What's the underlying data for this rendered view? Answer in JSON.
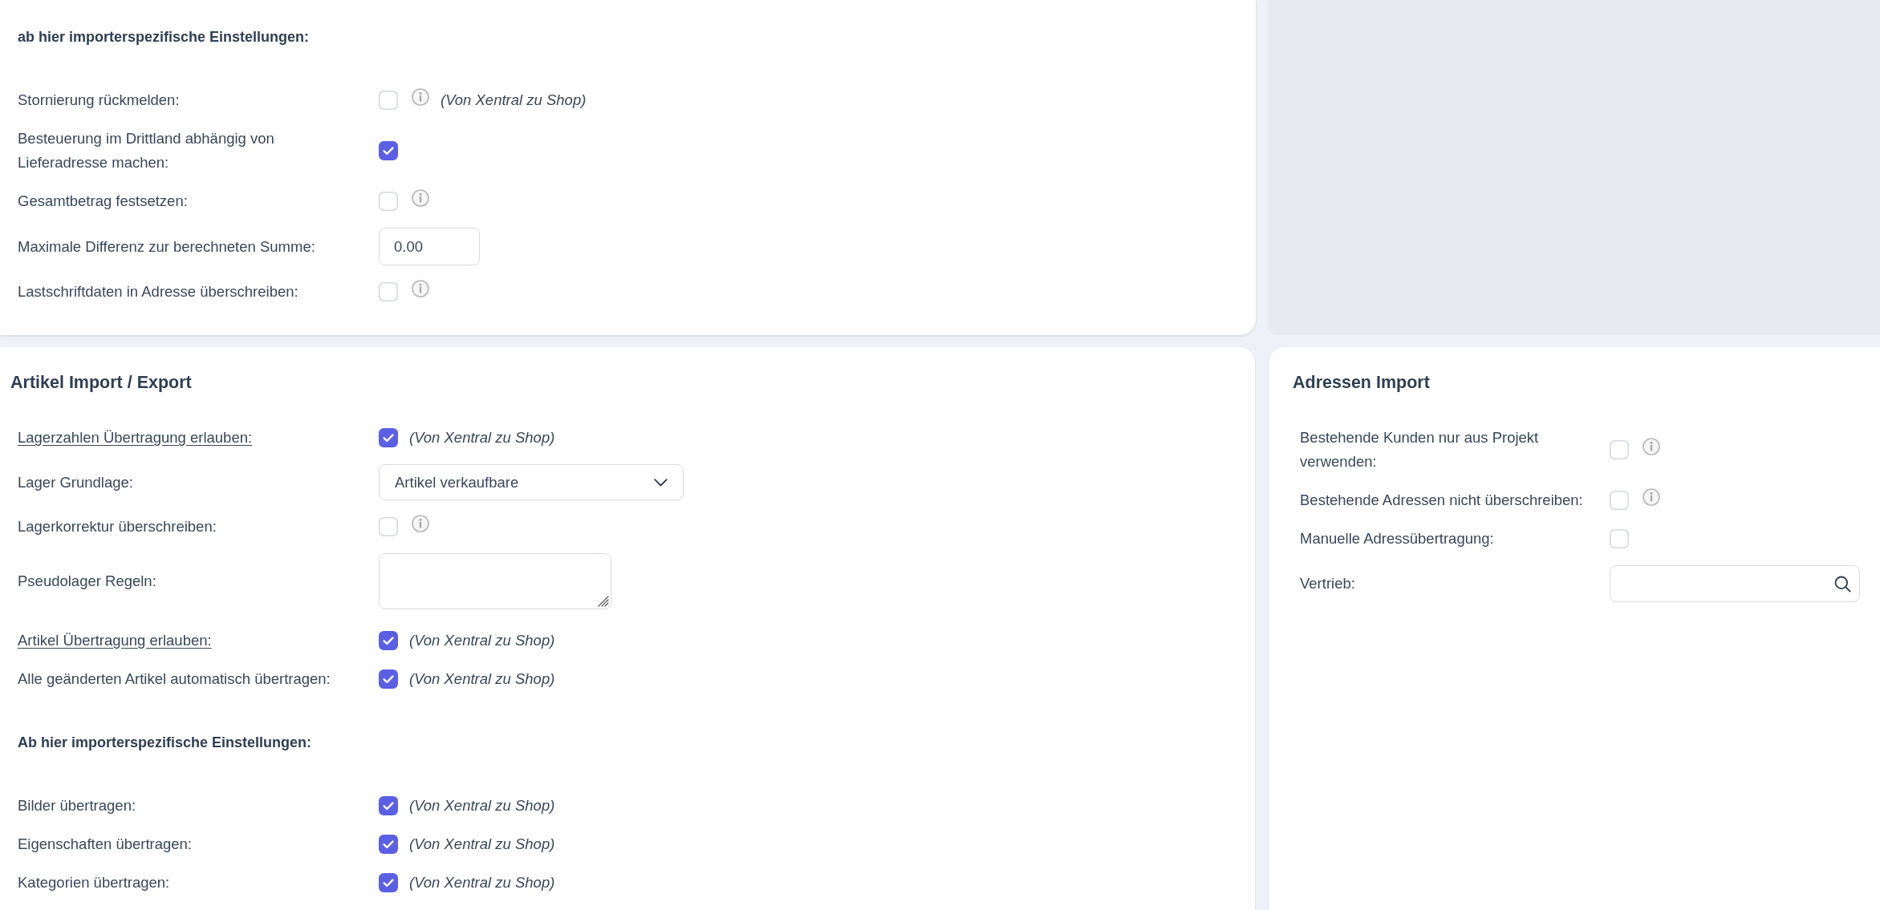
{
  "top_card": {
    "rows": [
      {
        "kind": "subheading",
        "text": "ab hier importerspezifische Einstellungen:"
      },
      {
        "kind": "checkbox",
        "label": "Stornierung rückmelden:",
        "link": false,
        "checked": false,
        "info": true,
        "note": "(Von Xentral zu Shop)"
      },
      {
        "kind": "checkbox",
        "label": "Besteuerung im Drittland abhängig von Lieferadresse machen:",
        "link": false,
        "checked": true,
        "info": false
      },
      {
        "kind": "checkbox",
        "label": "Gesamtbetrag festsetzen:",
        "link": false,
        "checked": false,
        "info": true
      },
      {
        "kind": "number",
        "label": "Maximale Differenz zur berechneten Summe:",
        "link": false,
        "value": "0.00"
      },
      {
        "kind": "checkbox",
        "label": "Lastschriftdaten in Adresse überschreiben:",
        "link": false,
        "checked": false,
        "info": true
      }
    ]
  },
  "artikel_card": {
    "title": "Artikel Import / Export",
    "rows": [
      {
        "kind": "checkbox",
        "label": "Lagerzahlen Übertragung erlauben:",
        "link": true,
        "checked": true,
        "info": false,
        "note": "(Von Xentral zu Shop)"
      },
      {
        "kind": "select",
        "label": "Lager Grundlage:",
        "link": false,
        "value": "Artikel verkaufbare"
      },
      {
        "kind": "checkbox",
        "label": "Lagerkorrektur überschreiben:",
        "link": false,
        "checked": false,
        "info": true
      },
      {
        "kind": "textarea",
        "label": "Pseudolager Regeln:",
        "link": false
      },
      {
        "kind": "checkbox",
        "label": "Artikel Übertragung erlauben:",
        "link": true,
        "checked": true,
        "info": false,
        "note": "(Von Xentral zu Shop)"
      },
      {
        "kind": "checkbox",
        "label": "Alle geänderten Artikel automatisch übertragen:",
        "link": false,
        "checked": true,
        "info": false,
        "note": "(Von Xentral zu Shop)"
      },
      {
        "kind": "subheading",
        "text": "Ab hier importerspezifische Einstellungen:"
      },
      {
        "kind": "checkbox",
        "label": "Bilder übertragen:",
        "link": false,
        "checked": true,
        "info": false,
        "note": "(Von Xentral zu Shop)"
      },
      {
        "kind": "checkbox",
        "label": "Eigenschaften übertragen:",
        "link": false,
        "checked": true,
        "info": false,
        "note": "(Von Xentral zu Shop)"
      },
      {
        "kind": "checkbox",
        "label": "Kategorien übertragen:",
        "link": false,
        "checked": true,
        "info": false,
        "note": "(Von Xentral zu Shop)"
      }
    ]
  },
  "adressen_card": {
    "title": "Adressen Import",
    "rows": [
      {
        "kind": "checkbox",
        "label": "Bestehende Kunden nur aus Projekt verwenden:",
        "link": false,
        "checked": false,
        "info": true
      },
      {
        "kind": "checkbox",
        "label": "Bestehende Adressen nicht überschreiben:",
        "link": false,
        "checked": false,
        "info": true
      },
      {
        "kind": "checkbox",
        "label": "Manuelle Adressübertragung:",
        "link": false,
        "checked": false,
        "info": false
      },
      {
        "kind": "search",
        "label": "Vertrieb:",
        "link": false
      }
    ]
  }
}
